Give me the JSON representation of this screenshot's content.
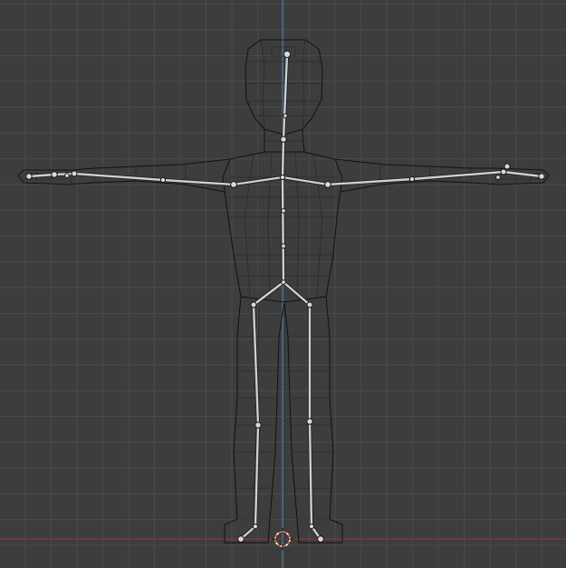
{
  "viewport": {
    "name": "3D Viewport",
    "view": "front-orthographic",
    "shading": "wireframe",
    "colors": {
      "background": "#3d3d3d",
      "grid": "#4a4a4a",
      "x_axis": "#8a3a3a",
      "z_axis": "#4a78a8",
      "wireframe": "#111111",
      "bone": "#d0d0d0",
      "cursor_ring": "#e06030"
    }
  },
  "objects": {
    "mesh": {
      "icon": "character-mesh",
      "pose": "t-pose"
    },
    "armature": {
      "icon": "armature-bones",
      "display": "stick"
    },
    "cursor": {
      "icon": "3d-cursor-icon"
    }
  }
}
